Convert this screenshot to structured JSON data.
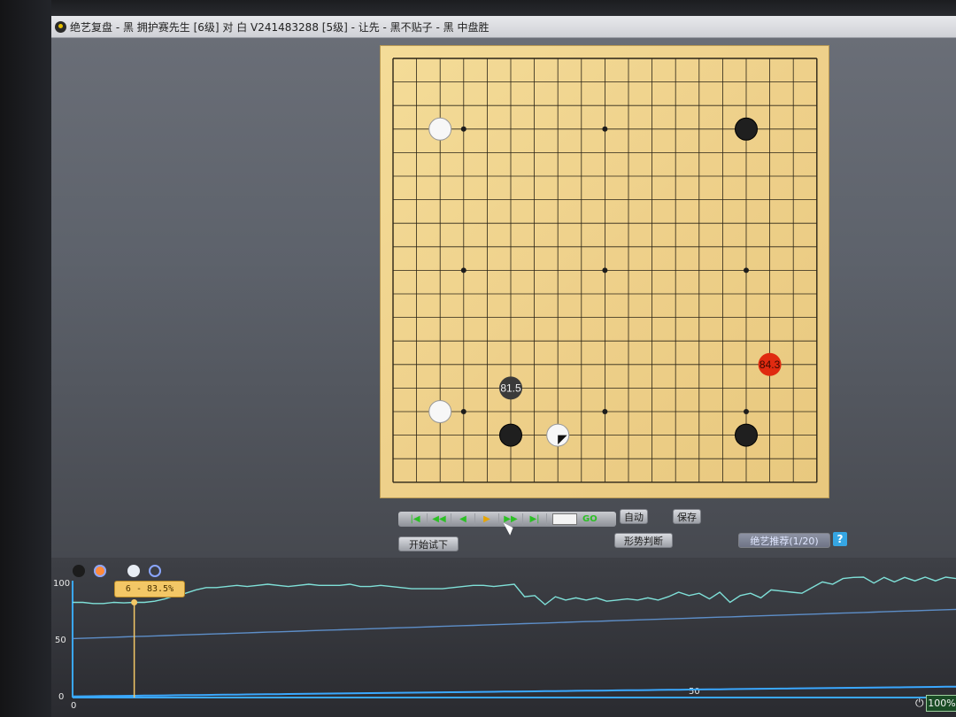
{
  "window": {
    "title": "绝艺复盘 - 黑 拥护赛先生 [6级] 对 白 V241483288 [5级] - 让先 - 黑不贴子 - 黑 中盘胜"
  },
  "board": {
    "size": 19,
    "stones": [
      {
        "color": "white",
        "col": 2,
        "row": 3
      },
      {
        "color": "black",
        "col": 15,
        "row": 3
      },
      {
        "color": "white",
        "col": 2,
        "row": 15
      },
      {
        "color": "black",
        "col": 5,
        "row": 16
      },
      {
        "color": "white",
        "col": 7,
        "row": 16,
        "last_move": true
      },
      {
        "color": "black",
        "col": 15,
        "row": 16
      }
    ],
    "hints": [
      {
        "color": "black",
        "col": 5,
        "row": 14,
        "label": "81.5"
      },
      {
        "color": "red",
        "col": 16,
        "row": 13,
        "label": "84.3"
      }
    ]
  },
  "controls": {
    "nav_icons": [
      "first-icon",
      "rewind-icon",
      "prev-icon",
      "play-icon",
      "forward-icon",
      "last-icon"
    ],
    "go_label": "GO",
    "auto_label": "自动",
    "save_label": "保存",
    "try_label": "开始试下",
    "judge_label": "形势判断",
    "recommend_label": "绝艺推荐(1/20)",
    "help_label": "?"
  },
  "chart_data": {
    "type": "line",
    "y_ticks": [
      "100",
      "50",
      "0"
    ],
    "x_ticks": [
      "0",
      "50"
    ],
    "ylim": [
      0,
      100
    ],
    "tooltip": "6 - 83.5%",
    "series": [
      {
        "color": "#7fe0d8",
        "values": [
          84,
          84,
          83,
          83,
          84,
          83.5,
          84,
          84,
          85,
          87,
          90,
          92,
          95,
          97,
          97,
          98,
          99,
          98,
          99,
          100,
          99,
          98,
          99,
          100,
          99,
          99,
          99,
          100,
          98,
          98,
          99,
          98,
          97,
          96,
          96,
          96,
          96,
          97,
          98,
          99,
          99,
          98,
          99,
          100,
          89,
          90,
          82,
          89,
          86,
          88,
          86,
          88,
          85,
          86,
          87,
          86,
          88,
          86,
          89,
          93,
          90,
          92,
          87,
          93,
          84,
          90,
          92,
          88,
          95,
          94,
          93,
          92,
          97,
          102,
          100,
          105,
          106,
          109,
          101,
          106,
          102,
          106,
          103,
          108,
          103,
          110,
          105
        ]
      },
      {
        "color": "#5d8ec8",
        "values": [
          52,
          52.3,
          52.6,
          52.9,
          53.2,
          53.5,
          53.8,
          54.1,
          54.4,
          54.7,
          55,
          55.3,
          55.6,
          55.9,
          56.2,
          56.5,
          56.8,
          57.1,
          57.4,
          57.7,
          58,
          58.3,
          58.6,
          58.9,
          59.2,
          59.5,
          59.8,
          60.1,
          60.4,
          60.7,
          61,
          61.3,
          61.6,
          61.9,
          62.2,
          62.5,
          62.8,
          63.1,
          63.4,
          63.7,
          64,
          64.3,
          64.6,
          64.9,
          65.2,
          65.5,
          65.8,
          66.1,
          66.4,
          66.7,
          67,
          67.3,
          67.6,
          67.9,
          68.2,
          68.5,
          68.8,
          69.1,
          69.4,
          69.7,
          70,
          70.3,
          70.6,
          70.9,
          71.2,
          71.5,
          71.8,
          72.1,
          72.4,
          72.7,
          73,
          73.3,
          73.6,
          73.9,
          74.2,
          74.5,
          74.8,
          75.1,
          75.4,
          75.7,
          76,
          76.3,
          76.6,
          76.9,
          77.2,
          77.5,
          77.8
        ]
      },
      {
        "color": "#3aa8ff",
        "values": [
          1,
          1.1,
          1.2,
          1.3,
          1.4,
          1.5,
          1.6,
          1.7,
          1.8,
          1.9,
          2,
          2.1,
          2.2,
          2.3,
          2.4,
          2.5,
          2.6,
          2.7,
          2.8,
          2.9,
          3,
          3.1,
          3.2,
          3.3,
          3.4,
          3.5,
          3.6,
          3.7,
          3.8,
          3.9,
          4,
          4.1,
          4.2,
          4.3,
          4.4,
          4.5,
          4.6,
          4.7,
          4.8,
          4.9,
          5,
          5.1,
          5.2,
          5.3,
          5.4,
          5.5,
          5.6,
          5.7,
          5.8,
          5.9,
          6,
          6.1,
          6.2,
          6.3,
          6.4,
          6.5,
          6.6,
          6.7,
          6.8,
          6.9,
          7,
          7.1,
          7.2,
          7.3,
          7.4,
          7.5,
          7.6,
          7.7,
          7.8,
          7.9,
          8,
          8.1,
          8.2,
          8.3,
          8.4,
          8.5,
          8.6,
          8.7,
          8.8,
          8.9,
          9,
          9.1,
          9.2,
          9.3,
          9.4,
          9.5,
          9.6
        ]
      }
    ],
    "marker_x": 6
  },
  "status": {
    "battery": "100%"
  }
}
